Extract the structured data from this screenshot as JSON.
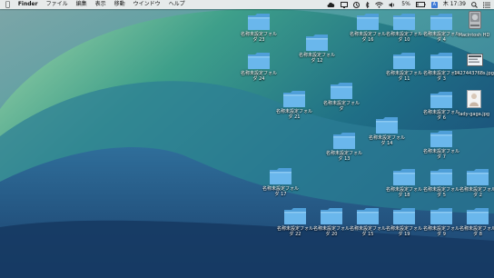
{
  "menubar": {
    "app_name": "Finder",
    "menus": [
      "ファイル",
      "編集",
      "表示",
      "移動",
      "ウインドウ",
      "ヘルプ"
    ],
    "battery_percent": "5%",
    "input_method": "A",
    "clock": "木 17:39"
  },
  "desktop": {
    "folders": [
      {
        "label": "名称未設定フォルダ 23"
      },
      {
        "label": "名称未設定フォルダ 12"
      },
      {
        "label": "名称未設定フォルダ 16"
      },
      {
        "label": "名称未設定フォルダ 10"
      },
      {
        "label": "名称未設定フォルダ 4"
      },
      {
        "label": "名称未設定フォルダ 24"
      },
      {
        "label": "名称未設定フォルダ 11"
      },
      {
        "label": "名称未設定フォルダ 3"
      },
      {
        "label": "名称未設定フォルダ"
      },
      {
        "label": "名称未設定フォルダ 21"
      },
      {
        "label": "名称未設定フォルダ 6"
      },
      {
        "label": "名称未設定フォルダ 14"
      },
      {
        "label": "名称未設定フォルダ 13"
      },
      {
        "label": "名称未設定フォルダ 7"
      },
      {
        "label": "名称未設定フォルダ 17"
      },
      {
        "label": "名称未設定フォルダ 18"
      },
      {
        "label": "名称未設定フォルダ 5"
      },
      {
        "label": "名称未設定フォルダ 2"
      },
      {
        "label": "名称未設定フォルダ 22"
      },
      {
        "label": "名称未設定フォルダ 20"
      },
      {
        "label": "名称未設定フォルダ 15"
      },
      {
        "label": "名称未設定フォルダ 19"
      },
      {
        "label": "名称未設定フォルダ 9"
      },
      {
        "label": "名称未設定フォルダ 8"
      }
    ],
    "drive": {
      "label": "Macintosh HD"
    },
    "screenshot_file": {
      "label": "1427443768s.jpg"
    },
    "image_file": {
      "label": "lady-gaga.jpg"
    }
  },
  "colors": {
    "folder_body": "#6ab7ec",
    "folder_tab": "#4f9fd9",
    "wallpaper_light": "#9fd3b0",
    "wallpaper_mid": "#2f8a8a",
    "wallpaper_dark": "#163e66"
  }
}
